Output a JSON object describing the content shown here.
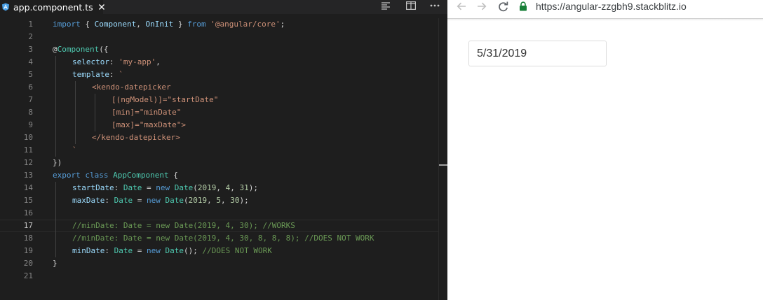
{
  "editor": {
    "tab": {
      "filename": "app.component.ts"
    },
    "toolbar": {
      "more_label": "···"
    },
    "lines": [
      {
        "n": "1",
        "indent": 0,
        "tokens": [
          {
            "t": "import",
            "c": "kw"
          },
          {
            "t": " { ",
            "c": "pun"
          },
          {
            "t": "Component",
            "c": "prop"
          },
          {
            "t": ", ",
            "c": "pun"
          },
          {
            "t": "OnInit",
            "c": "prop"
          },
          {
            "t": " } ",
            "c": "pun"
          },
          {
            "t": "from",
            "c": "kw"
          },
          {
            "t": " ",
            "c": "pun"
          },
          {
            "t": "'@angular/core'",
            "c": "str"
          },
          {
            "t": ";",
            "c": "pun"
          }
        ]
      },
      {
        "n": "2",
        "indent": 0,
        "tokens": []
      },
      {
        "n": "3",
        "indent": 0,
        "tokens": [
          {
            "t": "@",
            "c": "pun"
          },
          {
            "t": "Component",
            "c": "cls"
          },
          {
            "t": "({",
            "c": "pun"
          }
        ]
      },
      {
        "n": "4",
        "indent": 1,
        "tokens": [
          {
            "t": "selector",
            "c": "prop"
          },
          {
            "t": ": ",
            "c": "pun"
          },
          {
            "t": "'my-app'",
            "c": "str"
          },
          {
            "t": ",",
            "c": "pun"
          }
        ]
      },
      {
        "n": "5",
        "indent": 1,
        "tokens": [
          {
            "t": "template",
            "c": "prop"
          },
          {
            "t": ": ",
            "c": "pun"
          },
          {
            "t": "`",
            "c": "str"
          }
        ]
      },
      {
        "n": "6",
        "indent": 2,
        "tokens": [
          {
            "t": "<kendo-datepicker",
            "c": "str"
          }
        ]
      },
      {
        "n": "7",
        "indent": 3,
        "tokens": [
          {
            "t": "[(ngModel)]=\"startDate\"",
            "c": "str"
          }
        ]
      },
      {
        "n": "8",
        "indent": 3,
        "tokens": [
          {
            "t": "[min]=\"minDate\"",
            "c": "str"
          }
        ]
      },
      {
        "n": "9",
        "indent": 3,
        "tokens": [
          {
            "t": "[max]=\"maxDate\">",
            "c": "str"
          }
        ]
      },
      {
        "n": "10",
        "indent": 2,
        "tokens": [
          {
            "t": "</kendo-datepicker>",
            "c": "str"
          }
        ]
      },
      {
        "n": "11",
        "indent": 1,
        "tokens": [
          {
            "t": "`",
            "c": "str"
          }
        ]
      },
      {
        "n": "12",
        "indent": 0,
        "tokens": [
          {
            "t": "})",
            "c": "pun"
          }
        ]
      },
      {
        "n": "13",
        "indent": 0,
        "tokens": [
          {
            "t": "export",
            "c": "kw"
          },
          {
            "t": " ",
            "c": "pun"
          },
          {
            "t": "class",
            "c": "kw"
          },
          {
            "t": " ",
            "c": "pun"
          },
          {
            "t": "AppComponent",
            "c": "cls"
          },
          {
            "t": " {",
            "c": "pun"
          }
        ]
      },
      {
        "n": "14",
        "indent": 1,
        "tokens": [
          {
            "t": "startDate",
            "c": "prop"
          },
          {
            "t": ": ",
            "c": "pun"
          },
          {
            "t": "Date",
            "c": "cls"
          },
          {
            "t": " = ",
            "c": "pun"
          },
          {
            "t": "new",
            "c": "kw"
          },
          {
            "t": " ",
            "c": "pun"
          },
          {
            "t": "Date",
            "c": "cls"
          },
          {
            "t": "(",
            "c": "pun"
          },
          {
            "t": "2019",
            "c": "num"
          },
          {
            "t": ", ",
            "c": "pun"
          },
          {
            "t": "4",
            "c": "num"
          },
          {
            "t": ", ",
            "c": "pun"
          },
          {
            "t": "31",
            "c": "num"
          },
          {
            "t": ");",
            "c": "pun"
          }
        ]
      },
      {
        "n": "15",
        "indent": 1,
        "tokens": [
          {
            "t": "maxDate",
            "c": "prop"
          },
          {
            "t": ": ",
            "c": "pun"
          },
          {
            "t": "Date",
            "c": "cls"
          },
          {
            "t": " = ",
            "c": "pun"
          },
          {
            "t": "new",
            "c": "kw"
          },
          {
            "t": " ",
            "c": "pun"
          },
          {
            "t": "Date",
            "c": "cls"
          },
          {
            "t": "(",
            "c": "pun"
          },
          {
            "t": "2019",
            "c": "num"
          },
          {
            "t": ", ",
            "c": "pun"
          },
          {
            "t": "5",
            "c": "num"
          },
          {
            "t": ", ",
            "c": "pun"
          },
          {
            "t": "30",
            "c": "num"
          },
          {
            "t": ");",
            "c": "pun"
          }
        ]
      },
      {
        "n": "16",
        "indent": 1,
        "tokens": []
      },
      {
        "n": "17",
        "indent": 1,
        "active": true,
        "tokens": [
          {
            "t": "//minDate: Date = new Date(2019, 4, 30); //WORKS",
            "c": "com"
          }
        ]
      },
      {
        "n": "18",
        "indent": 1,
        "tokens": [
          {
            "t": "//minDate: Date = new Date(2019, 4, 30, 8, 8, 8); //DOES NOT WORK",
            "c": "com"
          }
        ]
      },
      {
        "n": "19",
        "indent": 1,
        "tokens": [
          {
            "t": "minDate",
            "c": "prop"
          },
          {
            "t": ": ",
            "c": "pun"
          },
          {
            "t": "Date",
            "c": "cls"
          },
          {
            "t": " = ",
            "c": "pun"
          },
          {
            "t": "new",
            "c": "kw"
          },
          {
            "t": " ",
            "c": "pun"
          },
          {
            "t": "Date",
            "c": "cls"
          },
          {
            "t": "(); ",
            "c": "pun"
          },
          {
            "t": "//DOES NOT WORK",
            "c": "com"
          }
        ]
      },
      {
        "n": "20",
        "indent": 0,
        "tokens": [
          {
            "t": "}",
            "c": "pun"
          }
        ]
      },
      {
        "n": "21",
        "indent": 0,
        "tokens": []
      }
    ]
  },
  "browser": {
    "url": "https://angular-zzgbh9.stackblitz.io",
    "datepicker": {
      "value": "5/31/2019"
    }
  },
  "colors": {
    "editor_bg": "#1e1e1e",
    "keyword": "#569cd6",
    "string": "#ce9178",
    "comment": "#6a9955",
    "lock_green": "#188038"
  }
}
